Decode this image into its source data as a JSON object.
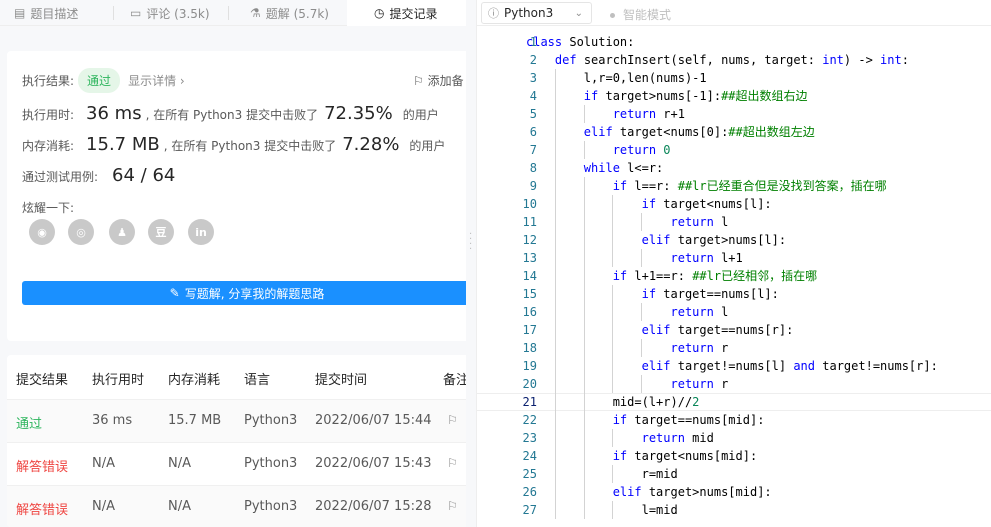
{
  "tabs": [
    {
      "label": "题目描述",
      "icon": "description-icon"
    },
    {
      "label": "评论 (3.5k)",
      "icon": "comment-icon"
    },
    {
      "label": "题解 (5.7k)",
      "icon": "flask-icon"
    },
    {
      "label": "提交记录",
      "icon": "clock-icon",
      "active": true
    }
  ],
  "result": {
    "label": "执行结果:",
    "status": "通过",
    "detail_link": "显示详情 ›",
    "add_note": "添加备"
  },
  "runtime": {
    "label": "执行用时:",
    "value": "36 ms",
    "prefix": ", 在所有 Python3 提交中击败了",
    "percent": "72.35%",
    "suffix": "的用户"
  },
  "memory": {
    "label": "内存消耗:",
    "value": "15.7 MB",
    "prefix": ", 在所有 Python3 提交中击败了",
    "percent": "7.28%",
    "suffix": "的用户"
  },
  "tests": {
    "label": "通过测试用例:",
    "value": "64 / 64"
  },
  "share": {
    "label": "炫耀一下:",
    "icons": [
      "wechat-icon",
      "weibo-icon",
      "qq-icon",
      "douban-icon",
      "linkedin-icon"
    ]
  },
  "write_button": "写题解, 分享我的解题思路",
  "table": {
    "headers": [
      "提交结果",
      "执行用时",
      "内存消耗",
      "语言",
      "提交时间",
      "备注"
    ],
    "rows": [
      {
        "status": "通过",
        "status_type": "ok",
        "time": "36 ms",
        "memory": "15.7 MB",
        "lang": "Python3",
        "submitted": "2022/06/07 15:44"
      },
      {
        "status": "解答错误",
        "status_type": "err",
        "time": "N/A",
        "memory": "N/A",
        "lang": "Python3",
        "submitted": "2022/06/07 15:43"
      },
      {
        "status": "解答错误",
        "status_type": "err",
        "time": "N/A",
        "memory": "N/A",
        "lang": "Python3",
        "submitted": "2022/06/07 15:28"
      }
    ]
  },
  "editor": {
    "language": "Python3",
    "smart_mode": "智能模式",
    "current_line": 21,
    "lines": [
      "class Solution:",
      "    def searchInsert(self, nums, target: int) -> int:",
      "        l,r=0,len(nums)-1",
      "        if target>nums[-1]:##超出数组右边",
      "            return r+1",
      "        elif target<nums[0]:##超出数组左边",
      "            return 0",
      "        while l<=r:",
      "            if l==r: ##lr已经重合但是没找到答案，插在哪",
      "                if target<nums[l]:",
      "                    return l",
      "                elif target>nums[l]:",
      "                    return l+1",
      "            if l+1==r: ##lr已经相邻，插在哪",
      "                if target==nums[l]:",
      "                    return l",
      "                elif target==nums[r]:",
      "                    return r",
      "                elif target!=nums[l] and target!=nums[r]:",
      "                    return r",
      "            mid=(l+r)//2",
      "            if target==nums[mid]:",
      "                return mid",
      "            if target<nums[mid]:",
      "                r=mid",
      "            elif target>nums[mid]:",
      "                l=mid"
    ]
  }
}
